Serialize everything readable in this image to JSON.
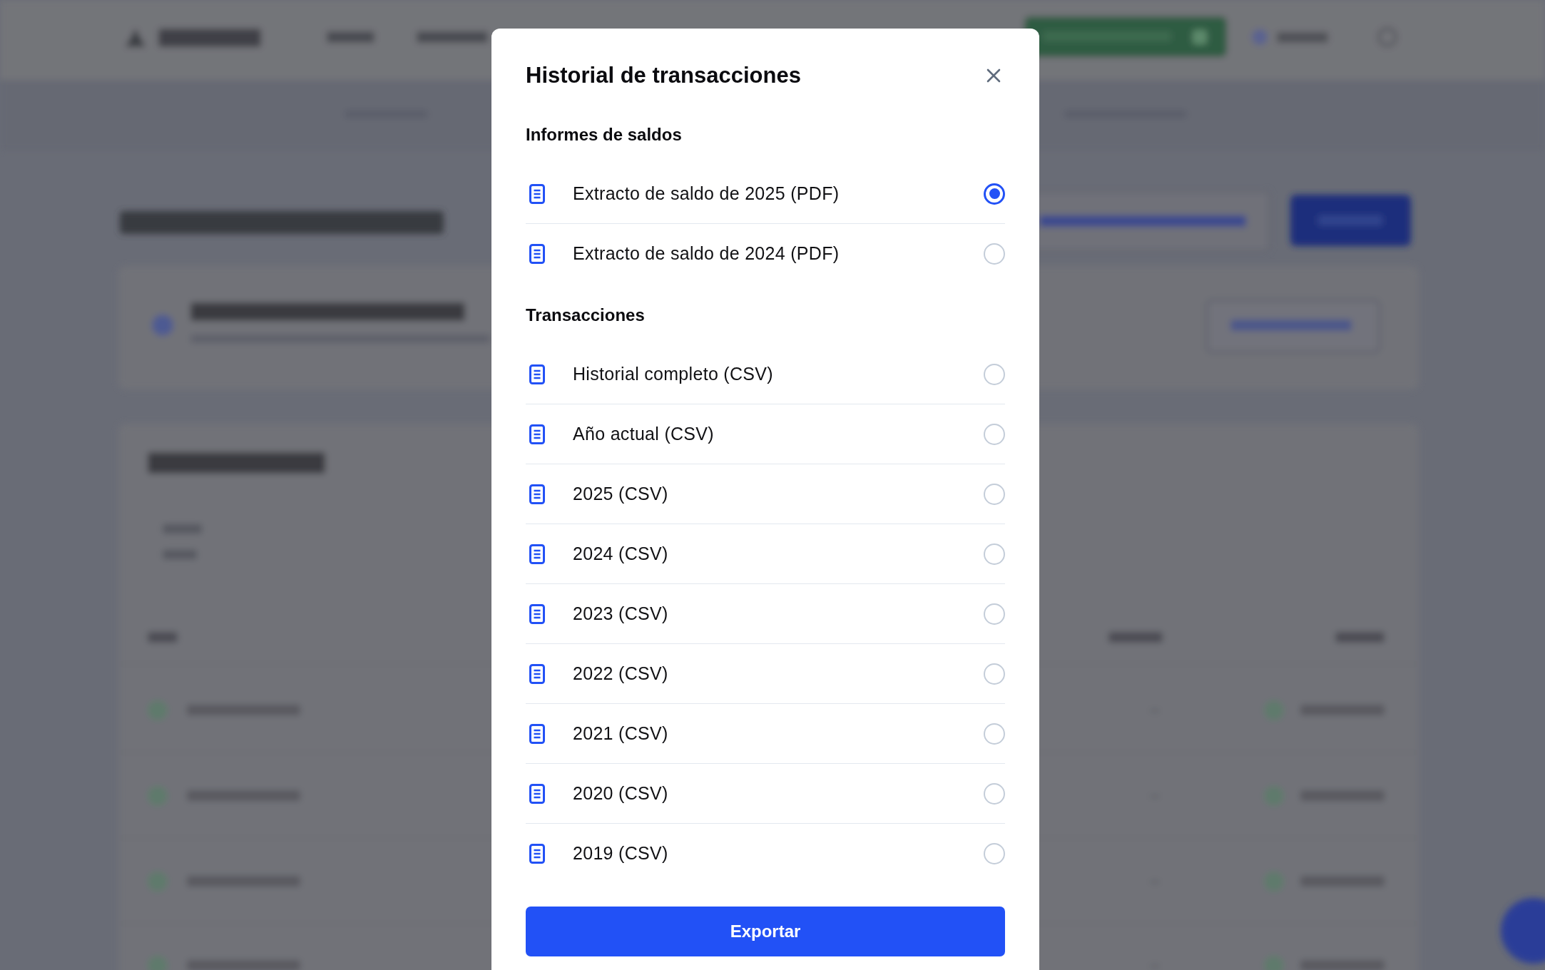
{
  "dialog": {
    "title": "Historial de transacciones",
    "sections": [
      {
        "heading": "Informes de saldos",
        "options": [
          {
            "label": "Extracto de saldo de 2025 (PDF)",
            "selected": true
          },
          {
            "label": "Extracto de saldo de 2024 (PDF)",
            "selected": false
          }
        ]
      },
      {
        "heading": "Transacciones",
        "options": [
          {
            "label": "Historial completo (CSV)",
            "selected": false
          },
          {
            "label": "Año actual (CSV)",
            "selected": false
          },
          {
            "label": "2025 (CSV)",
            "selected": false
          },
          {
            "label": "2024 (CSV)",
            "selected": false
          },
          {
            "label": "2023 (CSV)",
            "selected": false
          },
          {
            "label": "2022 (CSV)",
            "selected": false
          },
          {
            "label": "2021 (CSV)",
            "selected": false
          },
          {
            "label": "2020 (CSV)",
            "selected": false
          },
          {
            "label": "2019 (CSV)",
            "selected": false
          }
        ]
      }
    ],
    "submit_button": "Exportar"
  }
}
